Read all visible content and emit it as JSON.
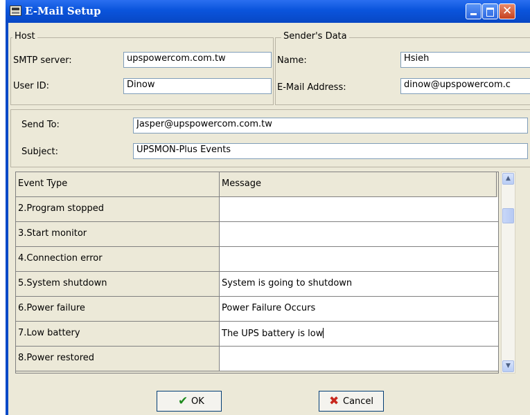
{
  "window": {
    "title": "E-Mail Setup"
  },
  "host": {
    "group_label": "Host",
    "smtp_label": "SMTP server:",
    "smtp_value": "upspowercom.com.tw",
    "user_label": "User ID:",
    "user_value": "Dinow"
  },
  "sender": {
    "group_label": "Sender's Data",
    "name_label": "Name:",
    "name_value": "Hsieh",
    "email_label": "E-Mail Address:",
    "email_value": "dinow@upspowercom.c"
  },
  "mail": {
    "send_to_label": "Send To:",
    "send_to_value": "Jasper@upspowercom.com.tw",
    "subject_label": "Subject:",
    "subject_value": "UPSMON-Plus Events"
  },
  "events_table": {
    "headers": [
      "Event Type",
      "Message"
    ],
    "rows": [
      {
        "type": "2.Program stopped",
        "message": ""
      },
      {
        "type": "3.Start monitor",
        "message": ""
      },
      {
        "type": "4.Connection error",
        "message": ""
      },
      {
        "type": "5.System shutdown",
        "message": "System is going to shutdown"
      },
      {
        "type": "6.Power failure",
        "message": "Power Failure Occurs"
      },
      {
        "type": "7.Low battery",
        "message": "The UPS battery is low"
      },
      {
        "type": "8.Power restored",
        "message": ""
      }
    ]
  },
  "buttons": {
    "ok_label": "OK",
    "cancel_label": "Cancel"
  },
  "icons": {
    "app": "email-setup-icon",
    "minimize": "minimize-icon",
    "maximize": "maximize-icon",
    "close": "close-icon",
    "ok": "checkmark-icon",
    "cancel": "x-icon"
  },
  "colors": {
    "titlebar": "#0a54dc",
    "ok_check": "#1e8a1e",
    "cancel_x": "#c8281e"
  }
}
